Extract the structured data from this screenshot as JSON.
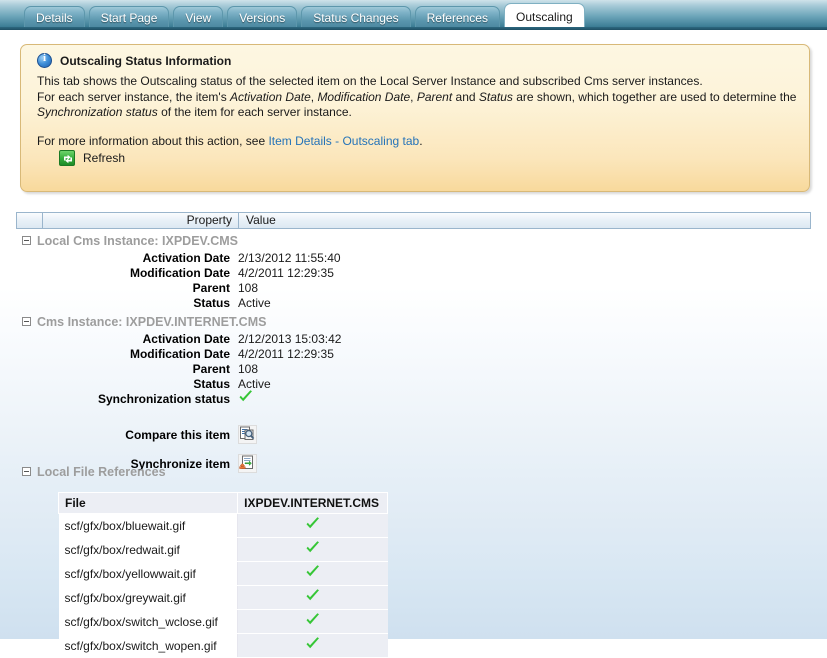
{
  "tabs": [
    {
      "label": "Details",
      "active": false
    },
    {
      "label": "Start Page",
      "active": false
    },
    {
      "label": "View",
      "active": false
    },
    {
      "label": "Versions",
      "active": false
    },
    {
      "label": "Status Changes",
      "active": false
    },
    {
      "label": "References",
      "active": false
    },
    {
      "label": "Outscaling",
      "active": true
    }
  ],
  "info": {
    "icon": "info-icon",
    "title": "Outscaling Status Information",
    "paragraph_1": "This tab shows the Outscaling status of the selected item on the Local Server Instance and subscribed Cms server instances.",
    "paragraph_2_pre": "For each server instance, the item's ",
    "em_1": "Activation Date",
    "sep_1": ", ",
    "em_2": "Modification Date",
    "sep_2": ", ",
    "em_3": "Parent",
    "sep_3": " and ",
    "em_4": "Status",
    "paragraph_2_post": " are shown, which together are used to determine the ",
    "em_5": "Synchronization status",
    "paragraph_2_end": " of the item for each server instance.",
    "more_pre": "For more information about this action, see ",
    "link_text": "Item Details - Outscaling tab",
    "more_post": ".",
    "refresh_label": "Refresh",
    "refresh_icon": "refresh-icon",
    "bg_color": "#fdf3d8",
    "border_color": "#d8b978"
  },
  "grid": {
    "header": {
      "property": "Property",
      "value": "Value"
    },
    "groups": [
      {
        "title": "Local Cms Instance: IXPDEV.CMS",
        "collapse_icon": "collapse-minus-icon",
        "rows": [
          {
            "name": "Activation Date",
            "value": "2/13/2012 11:55:40",
            "type": "text"
          },
          {
            "name": "Modification Date",
            "value": "4/2/2011 12:29:35",
            "type": "text"
          },
          {
            "name": "Parent",
            "value": "108",
            "type": "text"
          },
          {
            "name": "Status",
            "value": "Active",
            "type": "text"
          }
        ]
      },
      {
        "title": "Cms Instance: IXPDEV.INTERNET.CMS",
        "collapse_icon": "collapse-minus-icon",
        "rows": [
          {
            "name": "Activation Date",
            "value": "2/12/2013 15:03:42",
            "type": "text"
          },
          {
            "name": "Modification Date",
            "value": "4/2/2011 12:29:35",
            "type": "text"
          },
          {
            "name": "Parent",
            "value": "108",
            "type": "text"
          },
          {
            "name": "Status",
            "value": "Active",
            "type": "text"
          },
          {
            "name": "Synchronization status",
            "value": "",
            "type": "check"
          }
        ]
      }
    ],
    "actions": [
      {
        "label": "Compare this item",
        "icon": "compare-document-icon"
      },
      {
        "label": "Synchronize item",
        "icon": "synchronize-document-icon"
      }
    ]
  },
  "files": {
    "section_title": "Local File References",
    "collapse_icon": "collapse-minus-icon",
    "columns": [
      "File",
      "IXPDEV.INTERNET.CMS"
    ],
    "rows": [
      {
        "file": "scf/gfx/box/bluewait.gif",
        "status": "check"
      },
      {
        "file": "scf/gfx/box/redwait.gif",
        "status": "check"
      },
      {
        "file": "scf/gfx/box/yellowwait.gif",
        "status": "check"
      },
      {
        "file": "scf/gfx/box/greywait.gif",
        "status": "check"
      },
      {
        "file": "scf/gfx/box/switch_wclose.gif",
        "status": "check"
      },
      {
        "file": "scf/gfx/box/switch_wopen.gif",
        "status": "check"
      }
    ]
  },
  "colors": {
    "check_green": "#36c636",
    "tab_active_bg": "#ffffff",
    "link": "#2573b8",
    "group_title": "#9d9d9d"
  }
}
